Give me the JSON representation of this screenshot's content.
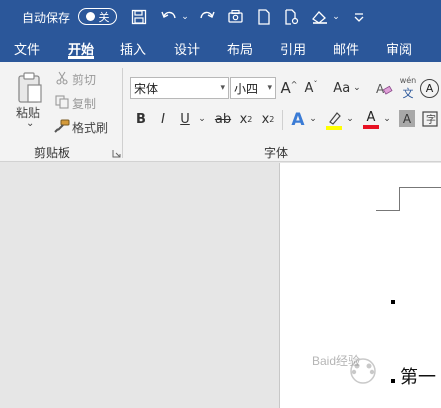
{
  "titlebar": {
    "autosave_label": "自动保存",
    "autosave_state": "关",
    "icons": [
      "save-icon",
      "undo-icon",
      "redo-icon",
      "touch-mode-icon",
      "new-document-icon",
      "print-preview-icon",
      "page-color-icon",
      "customize-quick-access-icon"
    ]
  },
  "tabs": [
    "文件",
    "开始",
    "插入",
    "设计",
    "布局",
    "引用",
    "邮件",
    "审阅"
  ],
  "active_tab": "开始",
  "clipboard": {
    "paste": "粘贴",
    "paste_arrow": "⌄",
    "cut": "剪切",
    "copy": "复制",
    "format_painter": "格式刷",
    "group_label": "剪贴板"
  },
  "font": {
    "font_name": "宋体",
    "font_size": "小四",
    "grow_label": "A",
    "shrink_label": "A",
    "case_label": "Aa",
    "bold": "B",
    "italic": "I",
    "underline": "U",
    "strike": "ab",
    "subscript": "x",
    "subscript_mark": "2",
    "superscript": "x",
    "superscript_mark": "2",
    "text_effect": "A",
    "font_color_label": "A",
    "shade_label": "A",
    "pinyin_top": "wén",
    "pinyin_bottom": "文",
    "enclose_label": "A",
    "group_label": "字体"
  },
  "document": {
    "visible_text": "第一",
    "watermark": "Baid经验"
  },
  "colors": {
    "accent": "#2b579a",
    "highlight": "#ffff00",
    "font_color": "#e81123",
    "text_effect": "#3a7bd5"
  }
}
